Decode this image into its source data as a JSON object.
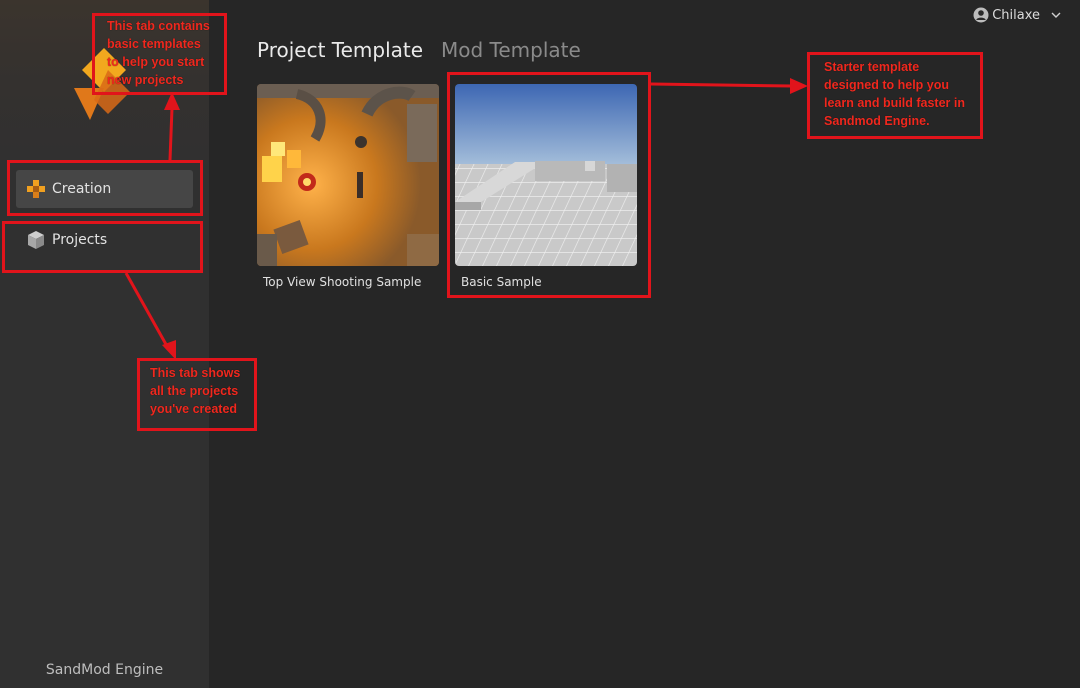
{
  "app": {
    "brand": "SandMod Engine"
  },
  "user": {
    "name": "Chilaxe",
    "avatar_icon": "user-circle-icon",
    "menu_icon": "chevron-down-icon"
  },
  "sidebar": {
    "items": [
      {
        "label": "Creation",
        "icon": "gamepad-icon",
        "active": true
      },
      {
        "label": "Projects",
        "icon": "cube-icon",
        "active": false
      }
    ]
  },
  "tabs": [
    {
      "label": "Project Template",
      "active": true
    },
    {
      "label": "Mod Template",
      "active": false
    }
  ],
  "templates": [
    {
      "label": "Top View Shooting Sample"
    },
    {
      "label": "Basic Sample"
    }
  ],
  "annotations": {
    "creation_tab": "This tab contains\nbasic templates\nto help you start\nnew projects",
    "projects_tab": "This tab shows\nall the projects\nyou've created",
    "basic_sample": "Starter template\ndesigned to help you\nlearn and build faster in\nSandmod Engine."
  },
  "colors": {
    "background": "#262626",
    "sidebar": "#303030",
    "active_nav": "#464646",
    "accent_orange": "#f0a020",
    "annotation_red": "#e1141b"
  }
}
